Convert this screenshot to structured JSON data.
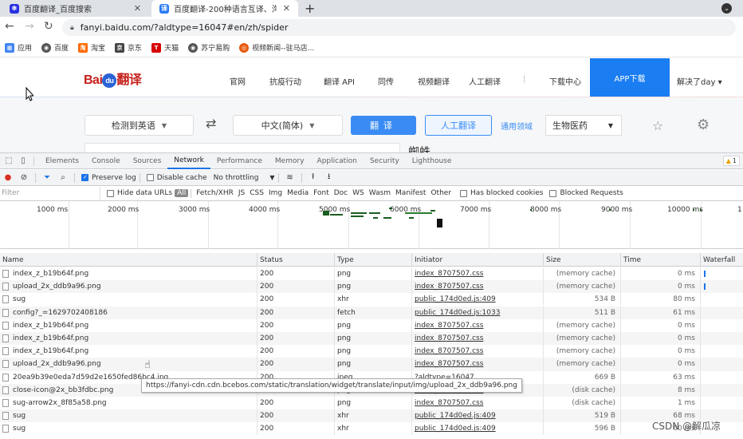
{
  "browser": {
    "tabs": [
      {
        "title": "百度翻译_百度搜索",
        "favicon_color": "#2932e1",
        "active": false
      },
      {
        "title": "百度翻译-200种语言互译、沟通...",
        "favicon_color": "#2a7af2",
        "active": true
      }
    ],
    "new_tab": "+",
    "url": "fanyi.baidu.com/?aldtype=16047#en/zh/spider",
    "bookmarks": [
      {
        "label": "应用",
        "color": "#4285f4"
      },
      {
        "label": "百度",
        "color": "#555555"
      },
      {
        "label": "淘宝",
        "color": "#ff6a00"
      },
      {
        "label": "京东",
        "color": "#444444"
      },
      {
        "label": "天猫",
        "color": "#d80000"
      },
      {
        "label": "苏宁易购",
        "color": "#555555"
      },
      {
        "label": "视频新闻--驻马店...",
        "color": "#e8590c"
      }
    ]
  },
  "page": {
    "logo": {
      "text1": "Bai",
      "du": "du",
      "text2": "翻译"
    },
    "nav": [
      "官网",
      "抗疫行动",
      "翻译 API",
      "同传",
      "视频翻译",
      "人工翻译",
      "|",
      "下载中心"
    ],
    "app_download": "APP下载",
    "user_menu": "解决了day ▾",
    "source_lang": "检测到英语",
    "target_lang": "中文(简体)",
    "translate_btn": "翻译",
    "human_btn": "人工翻译",
    "domain_label": "通用领域",
    "domain_value": "生物医药",
    "output_text": "蜘蛛"
  },
  "devtools": {
    "tabs": [
      "Elements",
      "Console",
      "Sources",
      "Network",
      "Performance",
      "Memory",
      "Application",
      "Security",
      "Lighthouse"
    ],
    "active_tab": "Network",
    "warning_count": "1",
    "preserve_log": "Preserve log",
    "disable_cache": "Disable cache",
    "throttling": "No throttling",
    "filter_placeholder": "Filter",
    "hide_data_urls": "Hide data URLs",
    "type_filters": [
      "All",
      "Fetch/XHR",
      "JS",
      "CSS",
      "Img",
      "Media",
      "Font",
      "Doc",
      "WS",
      "Wasm",
      "Manifest",
      "Other"
    ],
    "has_blocked_cookies": "Has blocked cookies",
    "blocked_requests": "Blocked Requests",
    "timeline_labels": [
      "1000 ms",
      "2000 ms",
      "3000 ms",
      "4000 ms",
      "5000 ms",
      "6000 ms",
      "7000 ms",
      "8000 ms",
      "9000 ms",
      "10000 ms",
      "1"
    ],
    "columns": [
      "Name",
      "Status",
      "Type",
      "Initiator",
      "Size",
      "Time",
      "Waterfall"
    ],
    "rows": [
      {
        "name": "index_z_b19b64f.png",
        "status": "200",
        "type": "png",
        "initiator": "index_8707507.css",
        "size": "(memory cache)",
        "time": "0 ms",
        "wf": true
      },
      {
        "name": "upload_2x_ddb9a96.png",
        "status": "200",
        "type": "png",
        "initiator": "index_8707507.css",
        "size": "(memory cache)",
        "time": "0 ms",
        "wf": true
      },
      {
        "name": "sug",
        "status": "200",
        "type": "xhr",
        "initiator": "public_174d0ed.js:409",
        "size": "534 B",
        "time": "80 ms",
        "wf": false
      },
      {
        "name": "config?_=1629702408186",
        "status": "200",
        "type": "fetch",
        "initiator": "public_174d0ed.js:1033",
        "size": "511 B",
        "time": "61 ms",
        "wf": false
      },
      {
        "name": "index_z_b19b64f.png",
        "status": "200",
        "type": "png",
        "initiator": "index_8707507.css",
        "size": "(memory cache)",
        "time": "0 ms",
        "wf": false
      },
      {
        "name": "index_z_b19b64f.png",
        "status": "200",
        "type": "png",
        "initiator": "index_8707507.css",
        "size": "(memory cache)",
        "time": "0 ms",
        "wf": false
      },
      {
        "name": "index_z_b19b64f.png",
        "status": "200",
        "type": "png",
        "initiator": "index_8707507.css",
        "size": "(memory cache)",
        "time": "0 ms",
        "wf": false
      },
      {
        "name": "upload_2x_ddb9a96.png",
        "status": "200",
        "type": "png",
        "initiator": "index_8707507.css",
        "size": "(memory cache)",
        "time": "0 ms",
        "wf": false
      },
      {
        "name": "20ea9b39e0eda7d59d2e1650fed86bc4.jpg",
        "status": "200",
        "type": "jpeg",
        "initiator": "?aldtype=16047",
        "size": "669 B",
        "time": "63 ms",
        "wf": false
      },
      {
        "name": "close-icon@2x_bb3fdbc.png",
        "status": "200",
        "type": "png",
        "initiator": "index_8707507.css",
        "size": "(disk cache)",
        "time": "8 ms",
        "wf": false
      },
      {
        "name": "sug-arrow2x_8f85a58.png",
        "status": "200",
        "type": "png",
        "initiator": "index_8707507.css",
        "size": "(disk cache)",
        "time": "1 ms",
        "wf": false
      },
      {
        "name": "sug",
        "status": "200",
        "type": "xhr",
        "initiator": "public_174d0ed.js:409",
        "size": "519 B",
        "time": "68 ms",
        "wf": false
      },
      {
        "name": "sug",
        "status": "200",
        "type": "xhr",
        "initiator": "public_174d0ed.js:409",
        "size": "596 B",
        "time": "60 ms",
        "wf": false
      }
    ],
    "tooltip": "https://fanyi-cdn.cdn.bcebos.com/static/translation/widget/translate/input/img/upload_2x_ddb9a96.png"
  },
  "watermark": "CSDN @解瓜凉"
}
